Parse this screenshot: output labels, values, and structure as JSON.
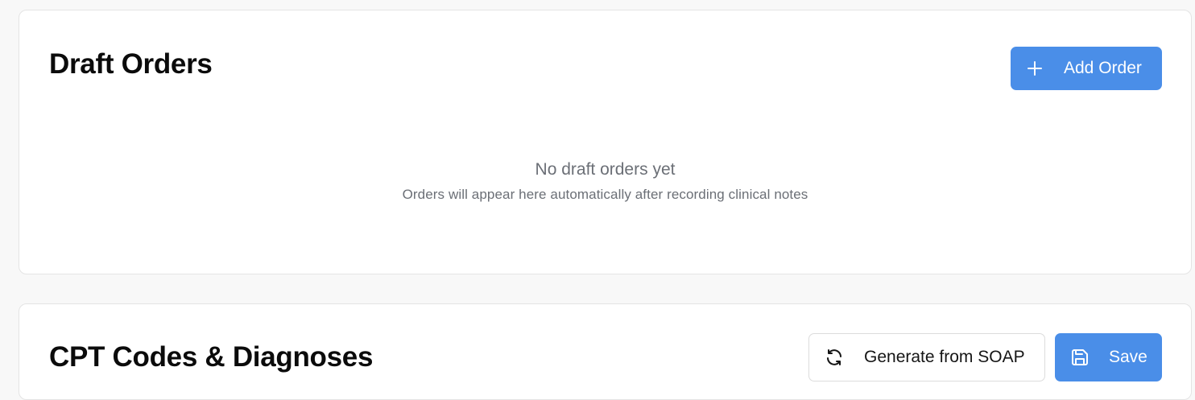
{
  "draft_orders": {
    "title": "Draft Orders",
    "add_button_label": "Add Order",
    "empty_title": "No draft orders yet",
    "empty_subtitle": "Orders will appear here automatically after recording clinical notes"
  },
  "cpt_codes": {
    "title": "CPT Codes & Diagnoses",
    "generate_button_label": "Generate from SOAP",
    "save_button_label": "Save"
  },
  "icons": {
    "add": "plus-icon",
    "generate": "refresh-icon",
    "save": "save-icon"
  },
  "colors": {
    "primary": "#4a8ee8",
    "muted_text": "#6b6f76",
    "page_background": "#f8f8f8"
  }
}
